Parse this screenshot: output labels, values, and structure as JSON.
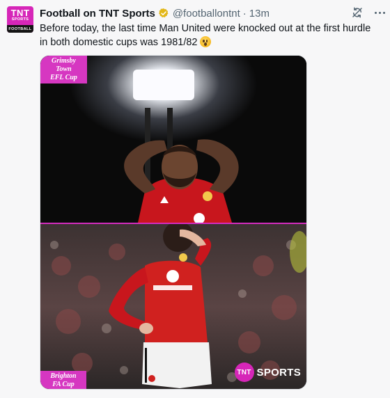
{
  "account": {
    "avatar_line1": "TNT",
    "avatar_line2": "SPORTS",
    "avatar_line3": "FOOTBALL",
    "display_name": "Football on TNT Sports",
    "handle": "@footballontnt",
    "separator": "·",
    "time": "13m"
  },
  "tweet": {
    "text": "Before today, the last time Man United were knocked out at the first hurdle in both domestic cups was 1981/82"
  },
  "media": {
    "top_badge": [
      "Grimsby Town",
      "EFL Cup"
    ],
    "bottom_badge": [
      "Brighton",
      "FA Cup"
    ],
    "watermark_logo": "TNT",
    "watermark_text": "SPORTS"
  },
  "icons": {
    "verified": "verified-badge-icon",
    "sync": "sync-icon",
    "more": "more-options-icon",
    "emoji": "astonished-face-emoji"
  },
  "colors": {
    "brand_pink": "#d626b8",
    "verified_gold": "#e2b719",
    "text_primary": "#0f1419",
    "text_secondary": "#536471"
  }
}
